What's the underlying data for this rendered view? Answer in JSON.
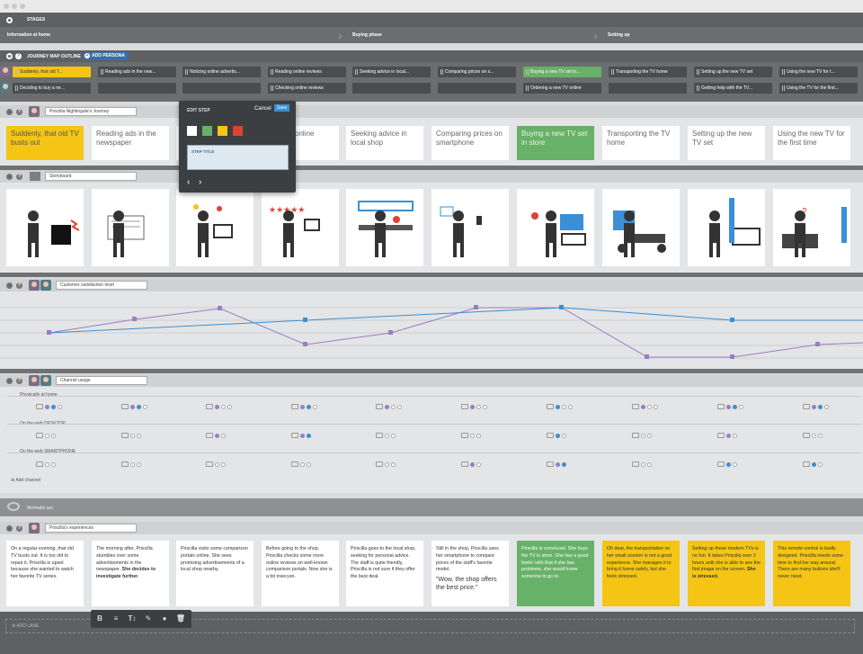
{
  "window": {
    "dots": [
      "close",
      "minimize",
      "maximize"
    ]
  },
  "stages": {
    "title": "STAGES",
    "items": [
      "Information at home",
      "Buying phase",
      "Setting up"
    ]
  },
  "outline": {
    "title": "JOURNEY MAP OUTLINE",
    "add_persona": "ADD PERSONA",
    "row1": [
      "Suddenly, that old T...",
      "Reading ads in the new...",
      "Noticing online advertis...",
      "Reading online reviews",
      "Seeking advice in local...",
      "Comparing prices on s...",
      "Buying a new TV set in...",
      "Transporting the TV home",
      "Setting up the new TV set",
      "Using the new TV for t..."
    ],
    "row2": [
      "Deciding to buy a ne...",
      "",
      "",
      "Checking online reviews",
      "",
      "",
      "Ordering a new TV online",
      "",
      "Getting help with the TV...",
      "Using the TV for the first..."
    ]
  },
  "journey": {
    "lane_title": "Priscilla Nightingale's Journey",
    "steps": [
      "Suddenly, that old TV busts out",
      "Reading ads in the newspaper",
      "",
      "Reading online reviews",
      "Seeking advice in local shop",
      "Comparing prices on smartphone",
      "Buying a new TV set in store",
      "Transporting the TV home",
      "Setting up the new TV set",
      "Using the new TV for the first time"
    ]
  },
  "edit_popup": {
    "title": "EDIT STEP",
    "cancel": "Cancel",
    "save": "Save",
    "colors": [
      "#ffffff",
      "#68b168",
      "#f4c514",
      "#e04030"
    ],
    "field_label": "STEP TITLE",
    "field_value": ""
  },
  "storyboard": {
    "lane_title": "Storyboard"
  },
  "satisfaction": {
    "lane_title": "Customer satisfaction level"
  },
  "channel": {
    "lane_title": "Channel usage",
    "rows": [
      "Physically at home",
      "On the web DESKTOP",
      "On the web SMARTPHONE"
    ],
    "add_channel": "Add channel"
  },
  "thematic": {
    "title": "thematic arc"
  },
  "experiences": {
    "lane_title": "Priscilla's experiences",
    "items": [
      {
        "text": "On a regular evening, that old TV busts out. It is too old to repair it. Priscilla is upset because she wanted to watch her favorite TV series."
      },
      {
        "text": "The morning after, Priscilla stumbles over some advertisements in the newspaper.",
        "bold": "She decides to investigate further."
      },
      {
        "text": "Priscilla visits some comparison portals online. She sees promising advertisements of a local shop nearby."
      },
      {
        "text": "Before going to the shop, Priscilla checks some more online reviews on well-known comparison portals. Now she is a bit insecure."
      },
      {
        "text": "Priscilla goes to the local shop, seeking for personal advice. The staff is quite friendly, Priscilla is not sure if they offer the best deal."
      },
      {
        "text": "Still in the shop, Priscilla uses her smartphone to compare prices of the staff's favorite model.",
        "quote": "\"Wow, the shop offers the best price.\""
      },
      {
        "text": "Priscilla is convinced. She buys the TV in store. She has a good feelin' with that if she has problems, she would know someone to go to."
      },
      {
        "text": "Oh dear, the transportation on her small scooter is not a good experience. She manages it to bring it home safely, but she feels stressed."
      },
      {
        "text": "Setting up these modern TVs is no fun. It takes Priscilla over 2 hours until she is able to see the first image on the screen.",
        "bold": "She is stressed."
      },
      {
        "text": "This remote control is badly designed. Priscilla needs some time to find her way around. There are many buttons she'll never need."
      }
    ]
  },
  "toolbar": {
    "buttons": [
      "B",
      "≡",
      "T↕",
      "✎",
      "●",
      "🗑"
    ]
  },
  "add_lane": "ADD LANE",
  "colors": {
    "bar_dark": "#5e6062",
    "bar_mid": "#767778",
    "accent_blue": "#3b8fd4",
    "purple": "#9b7cc3",
    "yellow": "#f4c514",
    "green": "#68b168"
  }
}
